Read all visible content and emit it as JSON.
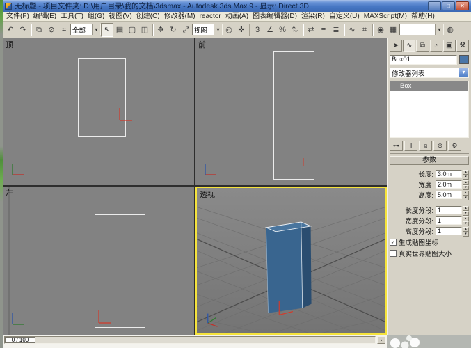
{
  "window": {
    "title": "无标题 - 项目文件夹: D:\\用户目录\\我的文档\\3dsmax - Autodesk 3ds Max 9 - 显示: Direct 3D",
    "controls": [
      {
        "name": "minimize-button",
        "glyph": "−"
      },
      {
        "name": "maximize-button",
        "glyph": "□"
      },
      {
        "name": "close-button",
        "glyph": "✕"
      }
    ]
  },
  "icons": {
    "dropdown_arrow": "▾",
    "spinner_up": "▴",
    "spinner_down": "▾",
    "checkmark": "✓",
    "next_frame": "›"
  },
  "menubar": {
    "items": [
      {
        "name": "file",
        "label": "文件(F)"
      },
      {
        "name": "edit",
        "label": "编辑(E)"
      },
      {
        "name": "tools",
        "label": "工具(T)"
      },
      {
        "name": "group",
        "label": "组(G)"
      },
      {
        "name": "views",
        "label": "视图(V)"
      },
      {
        "name": "create",
        "label": "创建(C)"
      },
      {
        "name": "modifiers",
        "label": "修改器(M)"
      },
      {
        "name": "reactor",
        "label": "reactor"
      },
      {
        "name": "animation",
        "label": "动画(A)"
      },
      {
        "name": "graph-editors",
        "label": "图表编辑器(D)"
      },
      {
        "name": "rendering",
        "label": "渲染(R)"
      },
      {
        "name": "customize",
        "label": "自定义(U)"
      },
      {
        "name": "maxscript",
        "label": "MAXScript(M)"
      },
      {
        "name": "help",
        "label": "帮助(H)"
      }
    ]
  },
  "toolbar": {
    "items": [
      {
        "type": "icon",
        "name": "undo-icon",
        "glyph": "↶"
      },
      {
        "type": "icon",
        "name": "redo-icon",
        "glyph": "↷"
      },
      {
        "type": "sep"
      },
      {
        "type": "icon",
        "name": "select-and-link-icon",
        "glyph": "⧉"
      },
      {
        "type": "icon",
        "name": "unlink-selection-icon",
        "glyph": "⊘"
      },
      {
        "type": "icon",
        "name": "bind-to-space-warp-icon",
        "glyph": "≈"
      },
      {
        "type": "combo",
        "name": "selection-filter-dropdown",
        "label": "全部"
      },
      {
        "type": "icon",
        "name": "select-object-icon",
        "glyph": "↖",
        "active": true
      },
      {
        "type": "icon",
        "name": "select-by-name-icon",
        "glyph": "▤"
      },
      {
        "type": "icon",
        "name": "rectangular-selection-region-icon",
        "glyph": "▢"
      },
      {
        "type": "icon",
        "name": "window-crossing-icon",
        "glyph": "◫"
      },
      {
        "type": "sep"
      },
      {
        "type": "icon",
        "name": "select-and-move-icon",
        "glyph": "✥"
      },
      {
        "type": "icon",
        "name": "select-and-rotate-icon",
        "glyph": "↻"
      },
      {
        "type": "icon",
        "name": "select-and-scale-icon",
        "glyph": "⤢"
      },
      {
        "type": "combo",
        "name": "reference-coordinate-dropdown",
        "label": "视图"
      },
      {
        "type": "icon",
        "name": "use-pivot-center-icon",
        "glyph": "◎"
      },
      {
        "type": "icon",
        "name": "select-and-manipulate-icon",
        "glyph": "✜"
      },
      {
        "type": "sep"
      },
      {
        "type": "icon",
        "name": "snap-toggle-3d-icon",
        "glyph": "3"
      },
      {
        "type": "icon",
        "name": "angle-snap-icon",
        "glyph": "∠"
      },
      {
        "type": "icon",
        "name": "percent-snap-icon",
        "glyph": "%"
      },
      {
        "type": "icon",
        "name": "spinner-snap-icon",
        "glyph": "⇅"
      },
      {
        "type": "sep"
      },
      {
        "type": "icon",
        "name": "mirror-icon",
        "glyph": "⇄"
      },
      {
        "type": "icon",
        "name": "align-icon",
        "glyph": "≡"
      },
      {
        "type": "icon",
        "name": "layer-manager-icon",
        "glyph": "≣"
      },
      {
        "type": "sep"
      },
      {
        "type": "icon",
        "name": "curve-editor-icon",
        "glyph": "∿"
      },
      {
        "type": "icon",
        "name": "schematic-view-icon",
        "glyph": "⌗"
      },
      {
        "type": "sep"
      },
      {
        "type": "icon",
        "name": "material-editor-icon",
        "glyph": "◉"
      },
      {
        "type": "icon",
        "name": "render-setup-icon",
        "glyph": "▦"
      },
      {
        "type": "combo",
        "name": "named-selection-sets-dropdown",
        "label": "",
        "wide": true
      },
      {
        "type": "icon",
        "name": "quick-render-icon",
        "glyph": "◍"
      }
    ]
  },
  "viewports": {
    "top_label": "顶",
    "front_label": "前",
    "left_label": "左",
    "perspective_label": "透视",
    "active_border_color": "#f5e33c"
  },
  "perspective_object": {
    "front_color": "#39658f",
    "side_color": "#2a4d70",
    "top_color": "#49759e",
    "edge_color": "#e8eef4"
  },
  "command_panel": {
    "tabs": [
      {
        "name": "tab-create",
        "glyph": "➤"
      },
      {
        "name": "tab-modify",
        "glyph": "∿",
        "active": true
      },
      {
        "name": "tab-hierarchy",
        "glyph": "⧉"
      },
      {
        "name": "tab-motion",
        "glyph": "◔"
      },
      {
        "name": "tab-display",
        "glyph": "▣"
      },
      {
        "name": "tab-utilities",
        "glyph": "⚒"
      }
    ],
    "object_name": "Box01",
    "object_color": "#4a76a8",
    "modifier_list_label": "修改器列表",
    "stack": [
      {
        "name": "stack-item-box",
        "label": "Box",
        "selected": true
      }
    ],
    "stack_buttons": [
      {
        "name": "pin-stack-button",
        "glyph": "⊶"
      },
      {
        "name": "show-end-result-button",
        "glyph": "‖"
      },
      {
        "name": "make-unique-button",
        "glyph": "⧈"
      },
      {
        "name": "remove-modifier-button",
        "glyph": "⊝"
      },
      {
        "name": "configure-modifier-sets-button",
        "glyph": "⚙"
      }
    ],
    "rollout_title": "参数",
    "fields": [
      {
        "name": "length-field",
        "label": "长度:",
        "value": "3.0m"
      },
      {
        "name": "width-field",
        "label": "宽度:",
        "value": "2.0m"
      },
      {
        "name": "height-field",
        "label": "高度:",
        "value": "5.0m"
      },
      {
        "name": "length-segs-field",
        "label": "长度分段:",
        "value": "1"
      },
      {
        "name": "width-segs-field",
        "label": "宽度分段:",
        "value": "1"
      },
      {
        "name": "height-segs-field",
        "label": "高度分段:",
        "value": "1"
      }
    ],
    "checkboxes": [
      {
        "name": "generate-mapping-coords-checkbox",
        "label": "生成贴图坐标",
        "checked": true
      },
      {
        "name": "real-world-map-size-checkbox",
        "label": "真实世界贴图大小",
        "checked": false
      }
    ]
  },
  "timeline": {
    "frame_indicator": "0 / 100"
  }
}
